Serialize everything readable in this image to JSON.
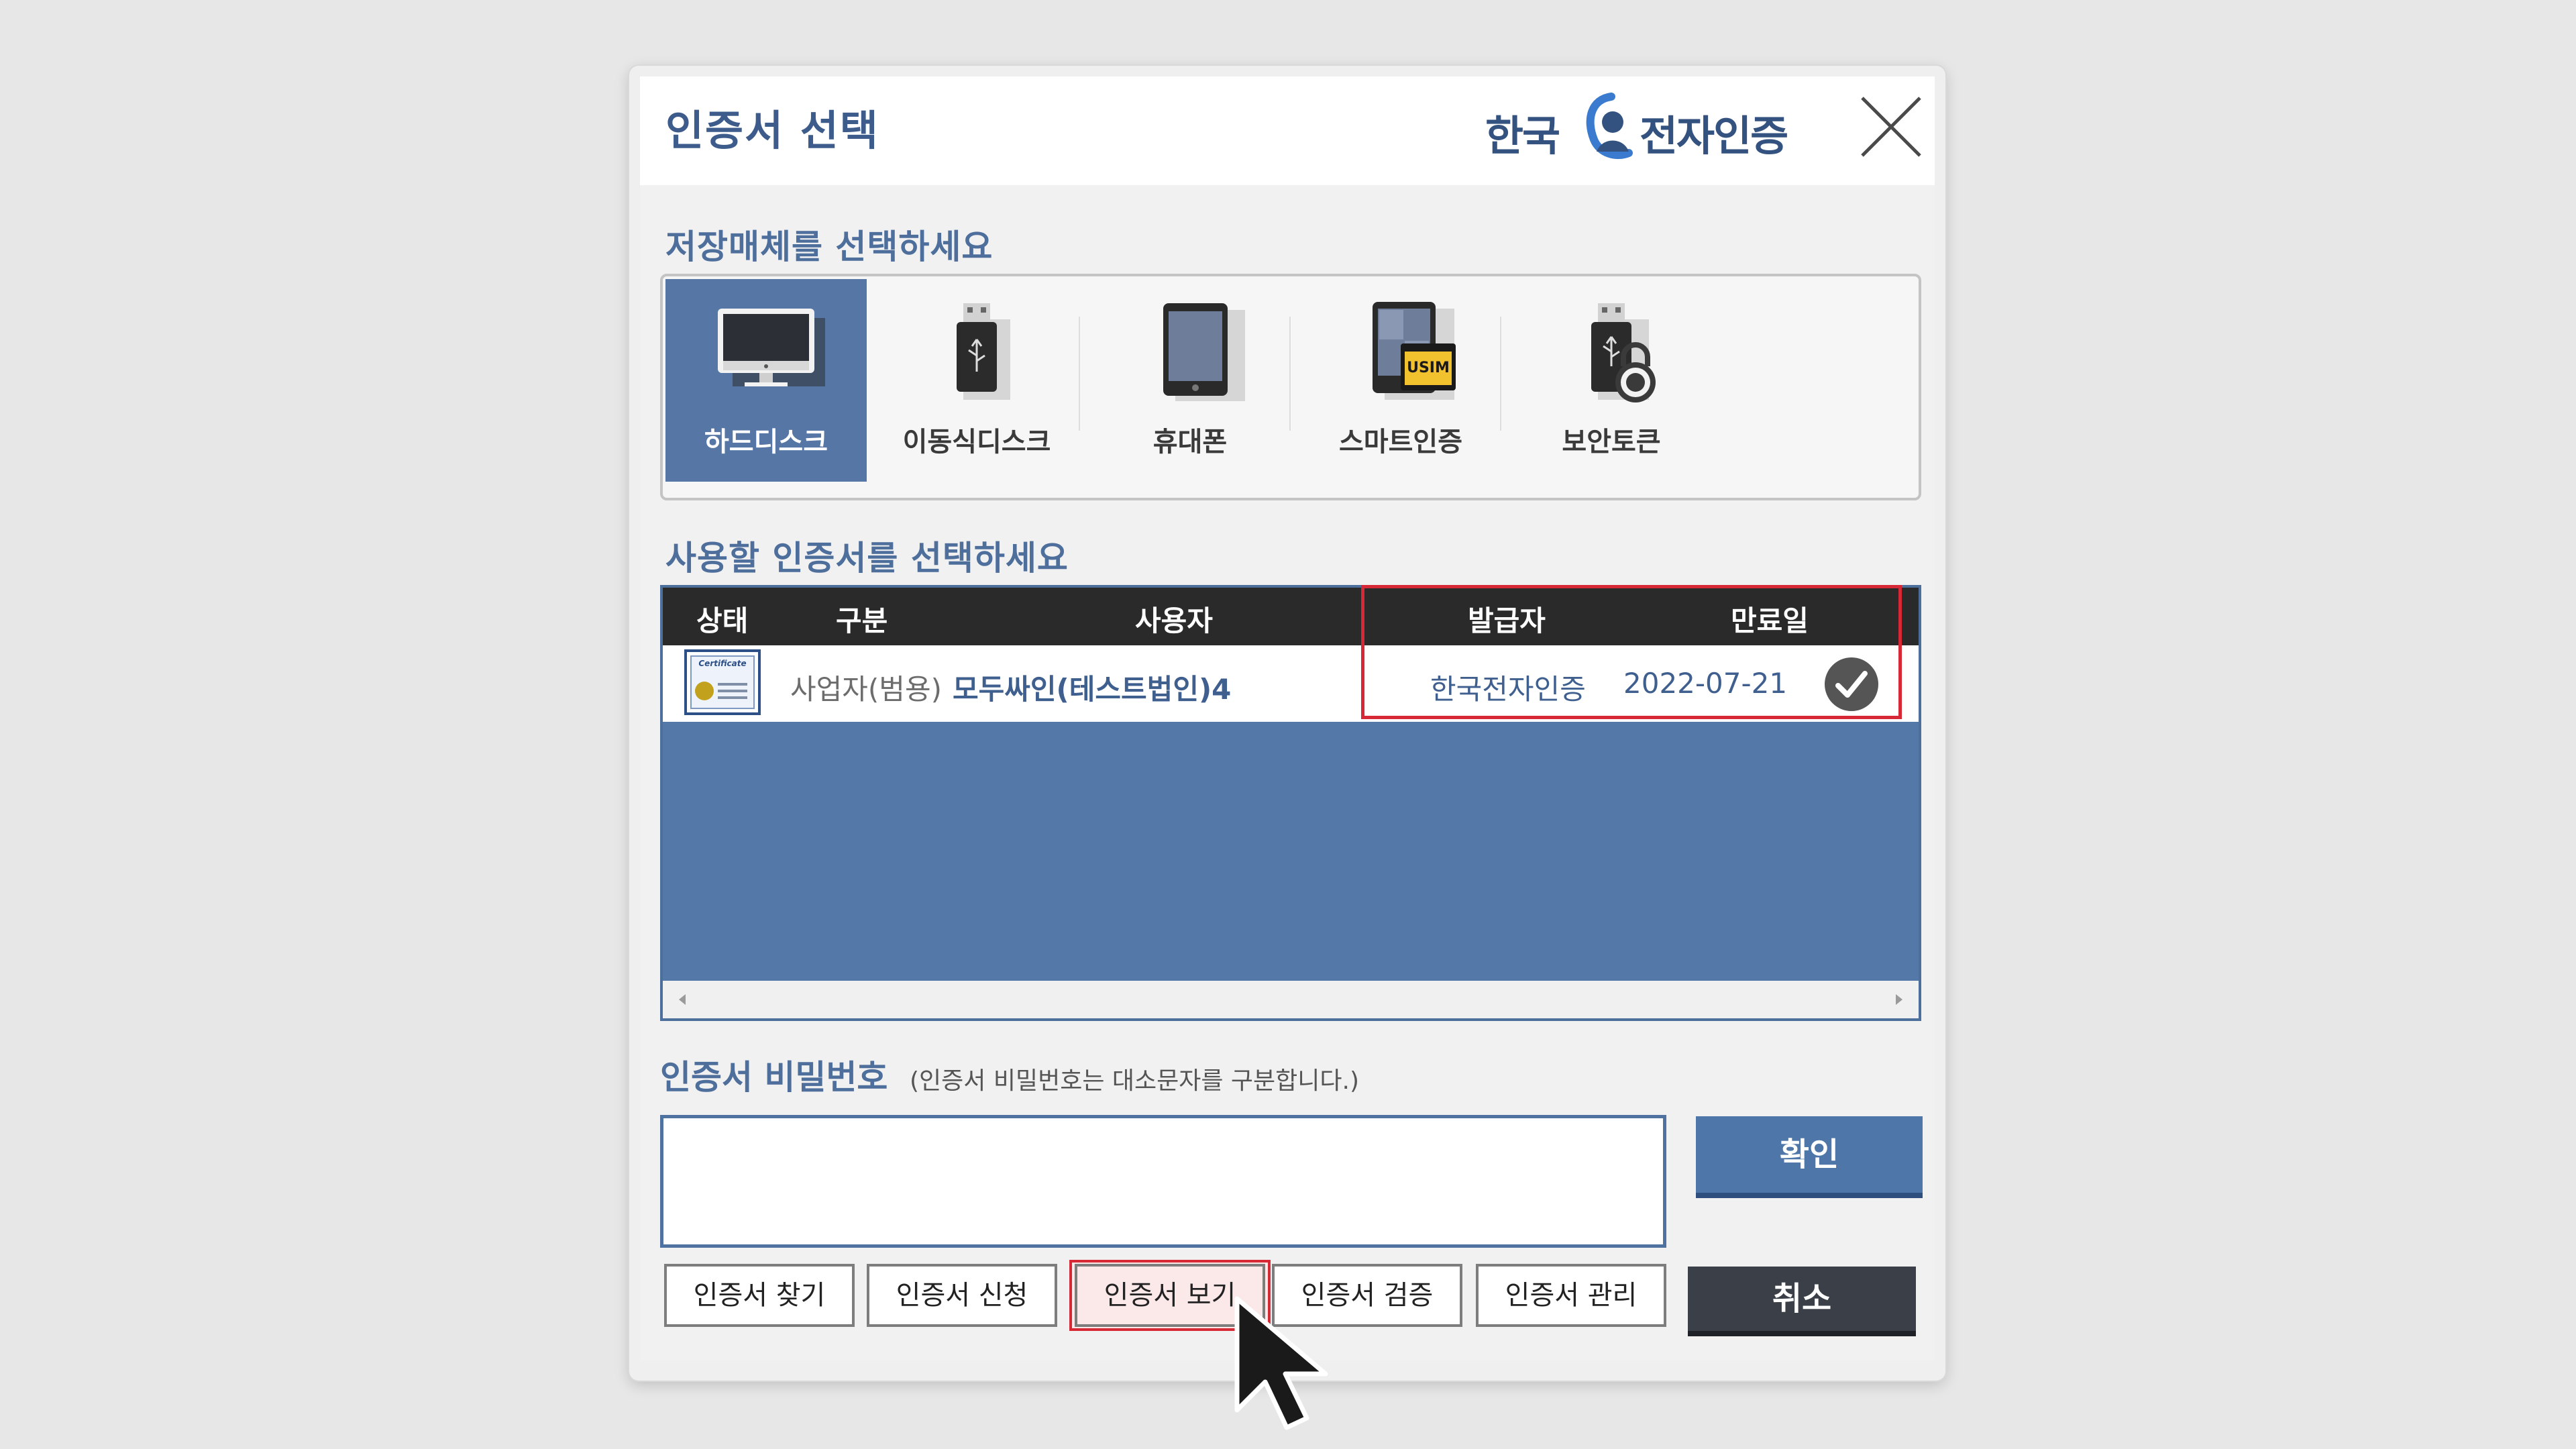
{
  "dialog": {
    "title": "인증서 선택",
    "brand": {
      "left": "한국",
      "right": "전자인증"
    }
  },
  "media": {
    "label": "저장매체를 선택하세요",
    "items": [
      {
        "label": "하드디스크",
        "icon": "monitor-icon",
        "selected": true
      },
      {
        "label": "이동식디스크",
        "icon": "usb-drive-icon",
        "selected": false
      },
      {
        "label": "휴대폰",
        "icon": "phone-icon",
        "selected": false
      },
      {
        "label": "스마트인증",
        "icon": "usim-icon",
        "selected": false,
        "badge": "USIM"
      },
      {
        "label": "보안토큰",
        "icon": "security-token-icon",
        "selected": false
      }
    ]
  },
  "certificates": {
    "label": "사용할 인증서를 선택하세요",
    "columns": [
      "상태",
      "구분",
      "사용자",
      "발급자",
      "만료일"
    ],
    "rows": [
      {
        "type": "사업자(범용)",
        "user": "모두싸인(테스트법인)4",
        "issuer": "한국전자인증",
        "expiry": "2022-07-21",
        "status_icon": "certificate-icon",
        "stamp_text": "Certificate"
      }
    ]
  },
  "password": {
    "label": "인증서 비밀번호",
    "note": "(인증서 비밀번호는 대소문자를 구분합니다.)",
    "value": "",
    "confirm_label": "확인"
  },
  "buttons": {
    "find": "인증서 찾기",
    "apply": "인증서 신청",
    "view": "인증서 보기",
    "verify": "인증서 검증",
    "manage": "인증서 관리",
    "cancel": "취소"
  },
  "colors": {
    "accent": "#5677a6",
    "highlight": "#d62935",
    "header_dark": "#2a2a2a"
  }
}
